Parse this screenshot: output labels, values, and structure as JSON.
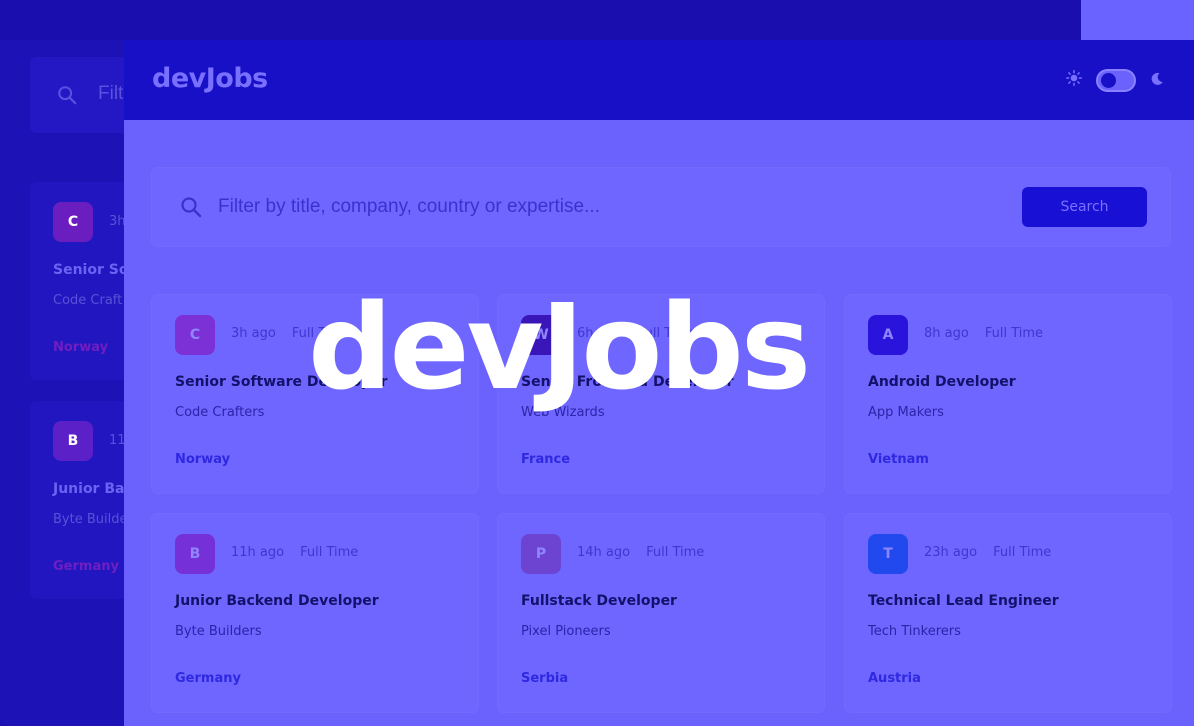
{
  "colors": {
    "accent": "#1910d6",
    "card_bg": "#6e66ff",
    "page_bg": "#6b62fe"
  },
  "back_screen": {
    "search_placeholder_fragment": "Filt",
    "cards": [
      {
        "logo_letter": "C",
        "logo_color": "#6a1ec0",
        "time_fragment": "3h",
        "title_fragment": "Senior So",
        "company_fragment": "Code Craft",
        "country": "Norway"
      },
      {
        "logo_letter": "B",
        "logo_color": "#5c20c8",
        "time_fragment": "11h",
        "title_fragment": "Junior Ba",
        "company_fragment": "Byte Builde",
        "country": "Germany"
      }
    ]
  },
  "header": {
    "brand": "devJobs",
    "theme_icons": [
      "sun-icon",
      "moon-icon"
    ]
  },
  "search": {
    "placeholder": "Filter by title, company, country or expertise...",
    "button_label": "Search"
  },
  "jobs": [
    {
      "logo_letter": "C",
      "logo_color": "#7b31d6",
      "posted": "3h ago",
      "contract": "Full Time",
      "title": "Senior Software Developer",
      "company": "Code Crafters",
      "country": "Norway"
    },
    {
      "logo_letter": "W",
      "logo_color": "#3a16b8",
      "posted": "6h ago",
      "contract": "Full Time",
      "title": "Senior Frontend Developer",
      "company": "Web Wizards",
      "country": "France"
    },
    {
      "logo_letter": "A",
      "logo_color": "#2a14dc",
      "posted": "8h ago",
      "contract": "Full Time",
      "title": "Android Developer",
      "company": "App Makers",
      "country": "Vietnam"
    },
    {
      "logo_letter": "B",
      "logo_color": "#7630d8",
      "posted": "11h ago",
      "contract": "Full Time",
      "title": "Junior Backend Developer",
      "company": "Byte Builders",
      "country": "Germany"
    },
    {
      "logo_letter": "P",
      "logo_color": "#6d43d2",
      "posted": "14h ago",
      "contract": "Full Time",
      "title": "Fullstack Developer",
      "company": "Pixel Pioneers",
      "country": "Serbia"
    },
    {
      "logo_letter": "T",
      "logo_color": "#2149ee",
      "posted": "23h ago",
      "contract": "Full Time",
      "title": "Technical Lead Engineer",
      "company": "Tech Tinkerers",
      "country": "Austria"
    }
  ],
  "overlay": {
    "title": "devJobs"
  }
}
